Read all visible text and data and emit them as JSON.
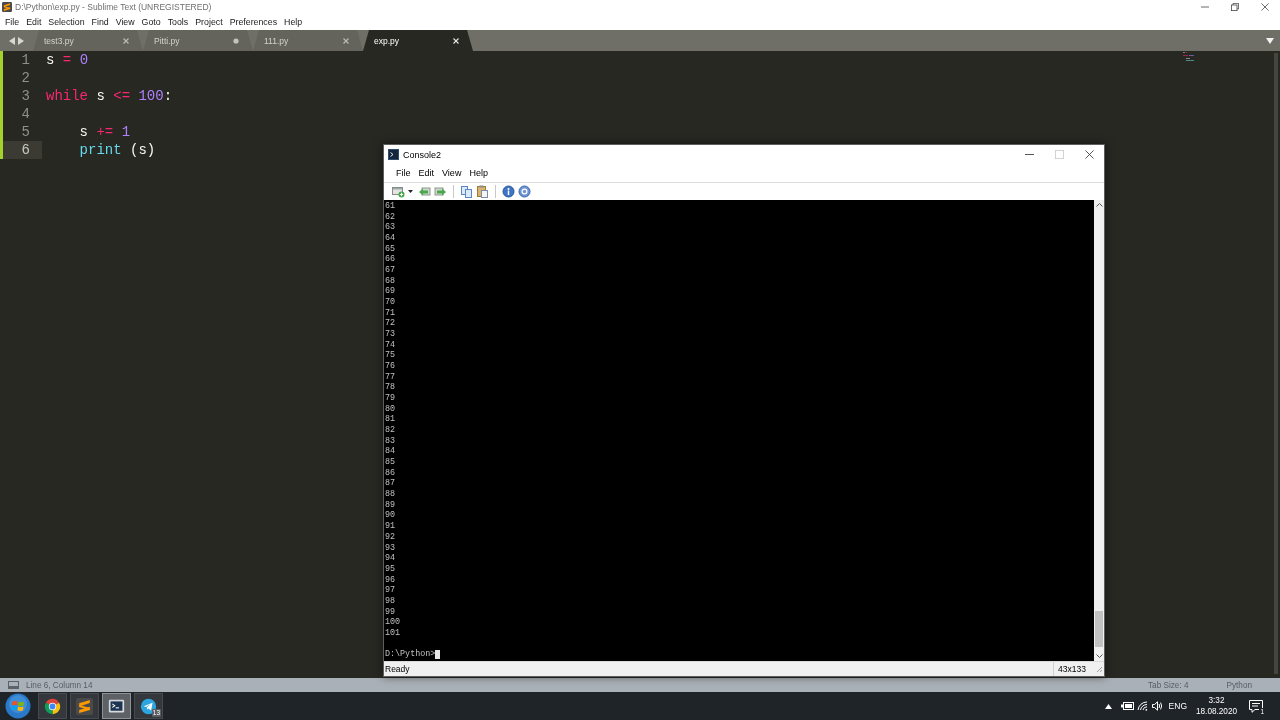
{
  "editor_window": {
    "title": "D:\\Python\\exp.py - Sublime Text (UNREGISTERED)",
    "menu": [
      "File",
      "Edit",
      "Selection",
      "Find",
      "View",
      "Goto",
      "Tools",
      "Project",
      "Preferences",
      "Help"
    ],
    "tabs": [
      {
        "label": "test3.py",
        "selected": false,
        "dirty": false
      },
      {
        "label": "Pitti.py",
        "selected": false,
        "dirty": true
      },
      {
        "label": "111.py",
        "selected": false,
        "dirty": false
      },
      {
        "label": "exp.py",
        "selected": true,
        "dirty": false
      }
    ],
    "code_lines": [
      {
        "number": "1",
        "current": false,
        "modified": true,
        "tokens": [
          {
            "text": "s ",
            "kind": "name"
          },
          {
            "text": "= ",
            "kind": "operator"
          },
          {
            "text": "0",
            "kind": "number"
          }
        ]
      },
      {
        "number": "2",
        "current": false,
        "modified": true
      },
      {
        "number": "3",
        "current": false,
        "modified": true,
        "tokens": [
          {
            "text": "while",
            "kind": "keyword"
          },
          {
            "text": " s ",
            "kind": "name"
          },
          {
            "text": "<= ",
            "kind": "operator"
          },
          {
            "text": "100",
            "kind": "number"
          },
          {
            "text": ":",
            "kind": "name"
          }
        ],
        "children": [
          {
            "number": "4",
            "current": false,
            "modified": true
          },
          {
            "number": "5",
            "current": false,
            "modified": true,
            "tokens": [
              {
                "text": "s ",
                "kind": "name"
              },
              {
                "text": "+= ",
                "kind": "operator"
              },
              {
                "text": "1",
                "kind": "number"
              }
            ]
          },
          {
            "number": "6",
            "current": true,
            "modified": true,
            "tokens": [
              {
                "text": "print",
                "kind": "builtin"
              },
              {
                "text": " (s)",
                "kind": "name"
              }
            ]
          }
        ]
      }
    ],
    "status_bar": {
      "position": "Line 6, Column 14",
      "tab_size": "Tab Size: 4",
      "syntax": "Python"
    }
  },
  "console_window": {
    "title": "Console2",
    "maximize_disabled": true,
    "menu": [
      "File",
      "Edit",
      "View",
      "Help"
    ],
    "output_lines": [
      "61",
      "62",
      "63",
      "64",
      "65",
      "66",
      "67",
      "68",
      "69",
      "70",
      "71",
      "72",
      "73",
      "74",
      "75",
      "76",
      "77",
      "78",
      "79",
      "80",
      "81",
      "82",
      "83",
      "84",
      "85",
      "86",
      "87",
      "88",
      "89",
      "90",
      "91",
      "92",
      "93",
      "94",
      "95",
      "96",
      "97",
      "98",
      "99",
      "100",
      "101"
    ],
    "prompt": "D:\\Python>",
    "status": "Ready",
    "size": "43x133"
  },
  "taskbar": {
    "apps": [
      {
        "kind": "browser",
        "selected": false
      },
      {
        "kind": "editor",
        "selected": false
      },
      {
        "kind": "terminal",
        "selected": true
      },
      {
        "kind": "messenger",
        "selected": false,
        "badge": "13"
      }
    ],
    "tray": {
      "language": "ENG",
      "time": "3:32",
      "date": "18.08.2020",
      "notifications": "1"
    }
  }
}
